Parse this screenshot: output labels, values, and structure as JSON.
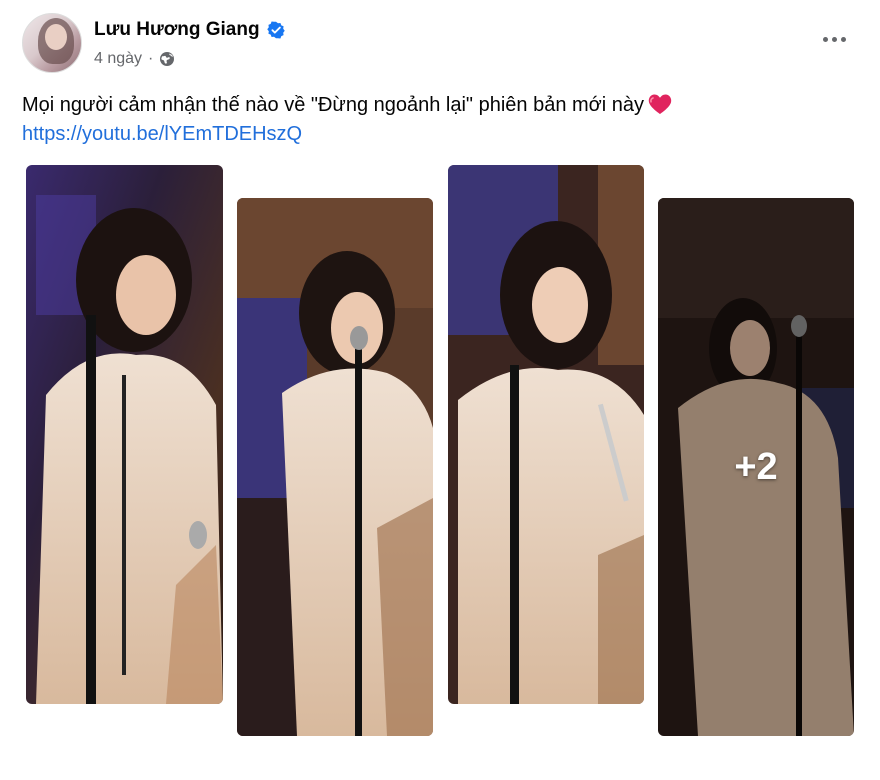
{
  "post": {
    "author_name": "Lưu Hương Giang",
    "time": "4 ngày",
    "text": "Mọi người cảm nhận thế nào về \"Đừng ngoảnh lại\" phiên bản mới này",
    "link": "https://youtu.be/lYEmTDEHszQ",
    "extra_photos": "+2"
  },
  "icons": {
    "verified": "verified-badge-icon",
    "audience": "globe-icon",
    "menu": "more-options-icon",
    "emoji": "red-heart-emoji"
  },
  "colors": {
    "link": "#216fdb",
    "verified": "#1877f2",
    "meta_text": "#65676b"
  }
}
